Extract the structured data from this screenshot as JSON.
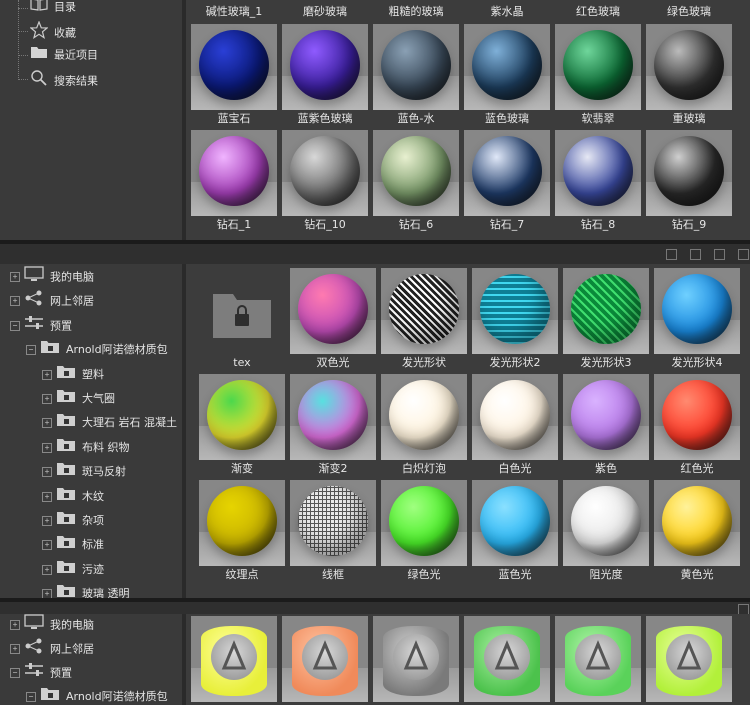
{
  "panel1": {
    "sidebar": [
      {
        "label": "目录",
        "icon": "book-icon"
      },
      {
        "label": "收藏",
        "icon": "star-icon"
      },
      {
        "label": "最近项目",
        "icon": "folder-icon"
      },
      {
        "label": "搜索结果",
        "icon": "search-icon"
      }
    ],
    "top_labels": [
      "碱性玻璃_1",
      "磨砂玻璃",
      "粗糙的玻璃",
      "紫水晶",
      "红色玻璃",
      "绿色玻璃"
    ],
    "rows": [
      [
        {
          "label": "蓝宝石",
          "color": "#0b1a7a",
          "hl": "#2a3fd6"
        },
        {
          "label": "蓝紫色玻璃",
          "color": "#3b1f9e",
          "hl": "#8f5bff"
        },
        {
          "label": "蓝色-水",
          "color": "#3a4a5a",
          "hl": "#8aa0b4"
        },
        {
          "label": "蓝色玻璃",
          "color": "#1d3e5e",
          "hl": "#7fb0d8"
        },
        {
          "label": "软翡翠",
          "color": "#0c6b35",
          "hl": "#6fd69b"
        },
        {
          "label": "重玻璃",
          "color": "#333333",
          "hl": "#bbbbbb"
        }
      ],
      [
        {
          "label": "钻石_1",
          "color": "#a43fb8",
          "hl": "#f0b4ff"
        },
        {
          "label": "钻石_10",
          "color": "#6e6e6e",
          "hl": "#d8d8d8"
        },
        {
          "label": "钻石_6",
          "color": "#7a9a6a",
          "hl": "#e8f0d0"
        },
        {
          "label": "钻石_7",
          "color": "#1f3c6a",
          "hl": "#e0e8f8"
        },
        {
          "label": "钻石_8",
          "color": "#3a4aa0",
          "hl": "#e6e8f4"
        },
        {
          "label": "钻石_9",
          "color": "#2a2a2a",
          "hl": "#cfcfcf"
        }
      ]
    ]
  },
  "panel2": {
    "tree": [
      {
        "label": "我的电脑",
        "icon": "computer-icon"
      },
      {
        "label": "网上邻居",
        "icon": "network-icon"
      },
      {
        "label": "预置",
        "icon": "sliders-icon"
      },
      {
        "label": "Arnold阿诺德材质包",
        "icon": "folder-lock-icon"
      },
      {
        "label": "塑料",
        "icon": "folder-lock-icon"
      },
      {
        "label": "大气圈",
        "icon": "folder-lock-icon"
      },
      {
        "label": "大理石 岩石 混凝土",
        "icon": "folder-lock-icon"
      },
      {
        "label": "布料 织物",
        "icon": "folder-lock-icon"
      },
      {
        "label": "斑马反射",
        "icon": "folder-lock-icon"
      },
      {
        "label": "木纹",
        "icon": "folder-lock-icon"
      },
      {
        "label": "杂项",
        "icon": "folder-lock-icon"
      },
      {
        "label": "标准",
        "icon": "folder-lock-icon"
      },
      {
        "label": "污迹",
        "icon": "folder-lock-icon"
      },
      {
        "label": "玻璃 透明",
        "icon": "folder-lock-icon"
      }
    ],
    "rows": [
      [
        {
          "label": "tex",
          "type": "folder"
        },
        {
          "label": "双色光",
          "color": "#c04db8",
          "hl": "#ff7ab0"
        },
        {
          "label": "发光形状",
          "color": "#333333",
          "hl": "#f0f0f0",
          "pattern": "mesh"
        },
        {
          "label": "发光形状2",
          "color": "#0e7f95",
          "hl": "#40d8f0",
          "pattern": "zigzag"
        },
        {
          "label": "发光形状3",
          "color": "#0a8a3a",
          "hl": "#40e070",
          "pattern": "diamond"
        },
        {
          "label": "发光形状4",
          "color": "#1a8adf",
          "hl": "#6fd0ff"
        }
      ],
      [
        {
          "label": "渐变",
          "color": "#e8e030",
          "hl": "#4cd84c"
        },
        {
          "label": "渐变2",
          "color": "#e070e0",
          "hl": "#58e0e0"
        },
        {
          "label": "白炽灯泡",
          "color": "#fff3dc",
          "hl": "#ffffff"
        },
        {
          "label": "白色光",
          "color": "#fff3e0",
          "hl": "#ffffff"
        },
        {
          "label": "紫色",
          "color": "#b77ae8",
          "hl": "#d9b2ff"
        },
        {
          "label": "红色光",
          "color": "#ff3a28",
          "hl": "#ff8a70"
        }
      ],
      [
        {
          "label": "纹理点",
          "color": "#c9b400",
          "hl": "#e6d400"
        },
        {
          "label": "线框",
          "color": "#cfcfcf",
          "hl": "#f4f4f4",
          "pattern": "grid"
        },
        {
          "label": "绿色光",
          "color": "#4cf02a",
          "hl": "#a0ff80"
        },
        {
          "label": "蓝色光",
          "color": "#2ab7f5",
          "hl": "#8ae0ff"
        },
        {
          "label": "阻光度",
          "color": "#e8e8e8",
          "hl": "#ffffff"
        },
        {
          "label": "黄色光",
          "color": "#ffd21a",
          "hl": "#fff29a"
        }
      ]
    ]
  },
  "panel3": {
    "tree": [
      {
        "label": "我的电脑",
        "icon": "computer-icon"
      },
      {
        "label": "网上邻居",
        "icon": "network-icon"
      },
      {
        "label": "预置",
        "icon": "sliders-icon"
      },
      {
        "label": "Arnold阿诺德材质包",
        "icon": "folder-lock-icon"
      }
    ],
    "cylinders": [
      {
        "color": "#e8ef3a",
        "hl": "#ffff9a"
      },
      {
        "color": "#f08a5a",
        "hl": "#ffc2a0"
      },
      {
        "color": "#7a7a7a",
        "hl": "#d0d0d0"
      },
      {
        "color": "#4cc24c",
        "hl": "#a8f0a0"
      },
      {
        "color": "#5ad25a",
        "hl": "#b0f4a8"
      },
      {
        "color": "#b2f03a",
        "hl": "#e8ff9a"
      }
    ]
  }
}
